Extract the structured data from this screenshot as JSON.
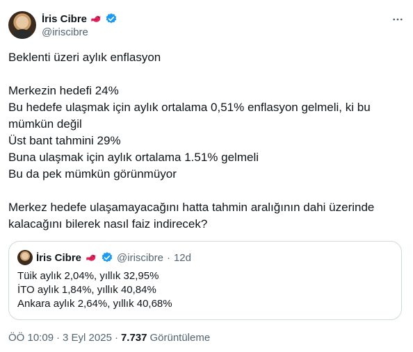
{
  "author": {
    "name": "İris Cibre",
    "handle": "@iriscibre"
  },
  "tweet": {
    "lines": [
      "Beklenti üzeri aylık enflasyon",
      "",
      "Merkezin hedefi 24%",
      "Bu hedefe ulaşmak için aylık ortalama 0,51% enflasyon gelmeli, ki bu",
      "mümkün değil",
      "Üst bant tahmini 29%",
      "Buna ulaşmak için aylık ortalama 1.51% gelmeli",
      "Bu da pek mümkün görünmüyor",
      "",
      "Merkez hedefe ulaşamayacağını hatta tahmin aralığının dahi üzerinde",
      "kalacağını bilerek nasıl faiz indirecek?"
    ]
  },
  "quote": {
    "name": "İris Cibre",
    "handle": "@iriscibre",
    "separator": "·",
    "age": "12d",
    "lines": [
      "Tüik aylık 2,04%,  yıllık 32,95%",
      "İTO aylık 1,84%, yıllık 40,84%",
      "Ankara aylık 2,64%, yıllık 40,68%"
    ]
  },
  "footer": {
    "time": "ÖÖ 10:09",
    "sep1": "·",
    "date": "3 Eyl 2025",
    "sep2": "·",
    "views_count": "7.737",
    "views_label": "Görüntüleme"
  },
  "colors": {
    "verified": "#1d9bf0",
    "bird": "#e0245e",
    "muted": "#536471",
    "text": "#0f1419",
    "border": "#cfd9de"
  },
  "icons": {
    "badge": "verified-badge-icon",
    "emoji": "red-bird-emoji-icon",
    "more": "more-horizontal-icon"
  }
}
